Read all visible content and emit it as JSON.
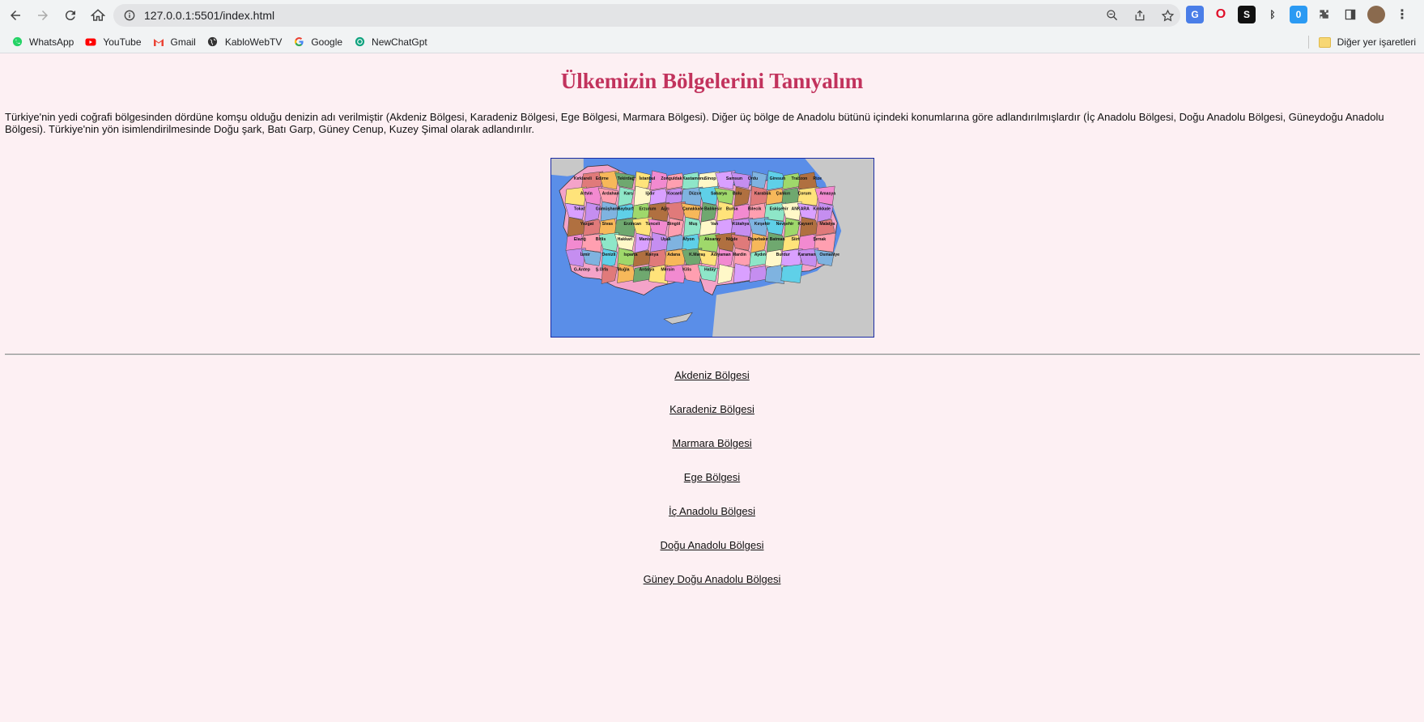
{
  "browser": {
    "url": "127.0.0.1:5501/index.html",
    "bookmarks": [
      {
        "label": "WhatsApp",
        "icon": "whatsapp-icon"
      },
      {
        "label": "YouTube",
        "icon": "youtube-icon"
      },
      {
        "label": "Gmail",
        "icon": "gmail-icon"
      },
      {
        "label": "KabloWebTV",
        "icon": "globe-icon"
      },
      {
        "label": "Google",
        "icon": "google-icon"
      },
      {
        "label": "NewChatGpt",
        "icon": "chatgpt-icon"
      }
    ],
    "other_bookmarks": "Diğer yer işaretleri"
  },
  "page": {
    "title": "Ülkemizin Bölgelerini Tanıyalım",
    "intro": "Türkiye'nin yedi coğrafi bölgesinden dördüne komşu olduğu denizin adı verilmiştir (Akdeniz Bölgesi, Karadeniz Bölgesi, Ege Bölgesi, Marmara Bölgesi). Diğer üç bölge de Anadolu bütünü içindeki konumlarına göre adlandırılmışlardır (İç Anadolu Bölgesi, Doğu Anadolu Bölgesi, Güneydoğu Anadolu Bölgesi). Türkiye'nin yön isimlendirilmesinde Doğu şark, Batı Garp, Güney Cenup, Kuzey Şimal olarak adlandırılır.",
    "links": [
      "Akdeniz Bölgesi",
      "Karadeniz Bölgesi",
      "Marmara Bölgesi",
      "Ege Bölgesi",
      "İç Anadolu Bölgesi",
      "Doğu Anadolu Bölgesi",
      "Güney Doğu Anadolu Bölgesi"
    ]
  },
  "map": {
    "labels": [
      "Kırklareli",
      "Edirne",
      "Tekirdağ",
      "İstanbul",
      "Zonguldak",
      "Kastamonu",
      "Sinop",
      "Samsun",
      "Ordu",
      "Giresun",
      "Trabzon",
      "Rize",
      "Artvin",
      "Ardahan",
      "Kars",
      "Iğdır",
      "Kocaeli",
      "Düzce",
      "Sakarya",
      "Bolu",
      "Karabük",
      "Çankırı",
      "Çorum",
      "Amasya",
      "Tokat",
      "Gümüşhane",
      "Bayburt",
      "Erzurum",
      "Ağrı",
      "Çanakkale",
      "Balıkesir",
      "Bursa",
      "Bilecik",
      "Eskişehir",
      "ANKARA",
      "Kırıkkale",
      "Yozgat",
      "Sivas",
      "Erzincan",
      "Tunceli",
      "Bingöl",
      "Muş",
      "Van",
      "Kütahya",
      "Kırşehir",
      "Nevşehir",
      "Kayseri",
      "Malatya",
      "Elazığ",
      "Bitlis",
      "Hakkari",
      "Manisa",
      "Uşak",
      "Afyon",
      "Aksaray",
      "Niğde",
      "Diyarbakır",
      "Batman",
      "Siirt",
      "Şırnak",
      "İzmir",
      "Denizli",
      "Isparta",
      "Konya",
      "Adana",
      "K.Maraş",
      "Adıyaman",
      "Mardin",
      "Aydın",
      "Burdur",
      "Karaman",
      "Osmaniye",
      "G.Antep",
      "Ş.Urfa",
      "Muğla",
      "Antalya",
      "Mersin",
      "Kilis",
      "Hatay"
    ],
    "colors": {
      "sea": "#5a8ee8",
      "land": "#c8c8c8",
      "border": "#1a2ba3"
    }
  }
}
